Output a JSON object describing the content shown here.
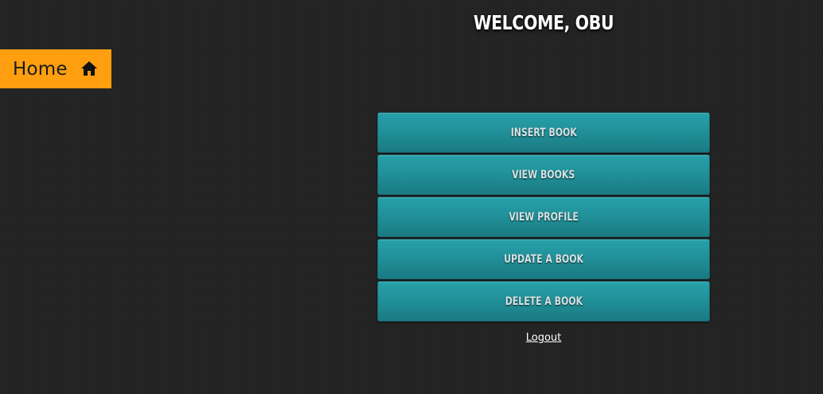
{
  "nav": {
    "home_label": "Home",
    "home_icon": "home-icon",
    "accent_color": "#ff9f0f"
  },
  "header": {
    "welcome_text": "WELCOME, OBU"
  },
  "menu": {
    "button_color": "#24979f",
    "items": [
      {
        "label": "INSERT BOOK"
      },
      {
        "label": "VIEW BOOKS"
      },
      {
        "label": "VIEW PROFILE"
      },
      {
        "label": "UPDATE A BOOK"
      },
      {
        "label": "DELETE A BOOK"
      }
    ]
  },
  "footer": {
    "logout_label": "Logout"
  }
}
